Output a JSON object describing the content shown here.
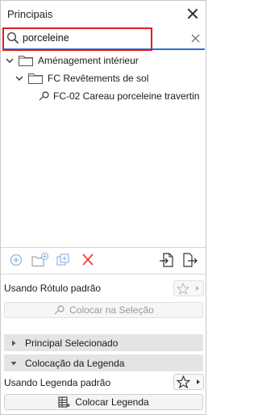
{
  "panel": {
    "title": "Principais"
  },
  "search": {
    "value": "porceleine",
    "placeholder": ""
  },
  "tree": {
    "items": [
      {
        "label": "Aménagement intérieur"
      },
      {
        "label": "FC Revêtements de sol"
      },
      {
        "label": "FC-02 Careau porceleine travertin"
      }
    ]
  },
  "toolbar": {
    "icons": [
      "add-icon",
      "new-folder-icon",
      "duplicate-icon",
      "delete-icon",
      "import-icon",
      "export-icon"
    ]
  },
  "label_section": {
    "text": "Usando Rótulo padrão",
    "button": "Colocar na Seleção"
  },
  "sections": {
    "selected": "Principal Selecionado",
    "legend_placement": "Colocação da Legenda"
  },
  "legend_section": {
    "text": "Usando Legenda padrão",
    "button": "Colocar Legenda"
  },
  "colors": {
    "accent": "#2a6fd6",
    "highlight": "#e21b1b",
    "delete": "#e5463a"
  }
}
